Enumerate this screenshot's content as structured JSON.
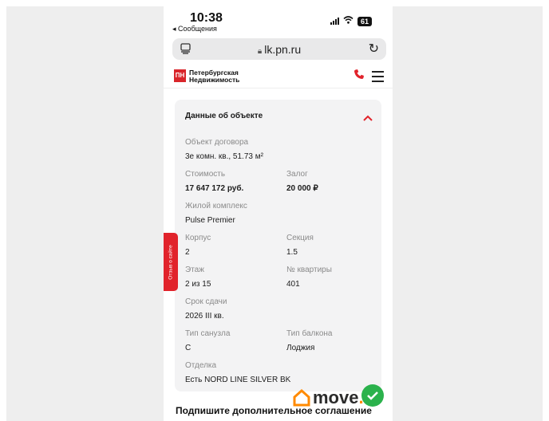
{
  "status_bar": {
    "time": "10:38",
    "back_label": "◂ Сообщения",
    "battery": "61"
  },
  "browser": {
    "url": "lk.pn.ru"
  },
  "site": {
    "logo_line1": "Петербургская",
    "logo_line2": "Недвижимость"
  },
  "card": {
    "title": "Данные об объекте",
    "fields": [
      {
        "label": "Объект договора",
        "value": "3е комн. кв., 51.73 м²"
      },
      {
        "label": "Стоимость",
        "value": "17 647 172 руб."
      },
      {
        "label": "Залог",
        "value": "20 000 ₽"
      },
      {
        "label": "Жилой комплекс",
        "value": "Pulse Premier"
      },
      {
        "label": "Корпус",
        "value": "2"
      },
      {
        "label": "Секция",
        "value": "1.5"
      },
      {
        "label": "Этаж",
        "value": "2 из 15"
      },
      {
        "label": "№ квартиры",
        "value": "401"
      },
      {
        "label": "Срок сдачи",
        "value": "2026 III кв."
      },
      {
        "label": "Тип санузла",
        "value": "С"
      },
      {
        "label": "Тип балкона",
        "value": "Лоджия"
      },
      {
        "label": "Отделка",
        "value": "Есть NORD LINE SILVER BK"
      }
    ]
  },
  "feedback_tab": "Отзыв о сайте",
  "bottom_heading": "Подпишите дополнительное соглашение",
  "watermark": {
    "name": "move",
    "suffix": ".ru"
  },
  "colors": {
    "brand_red": "#d9252a",
    "card_bg": "#f3f3f4"
  }
}
